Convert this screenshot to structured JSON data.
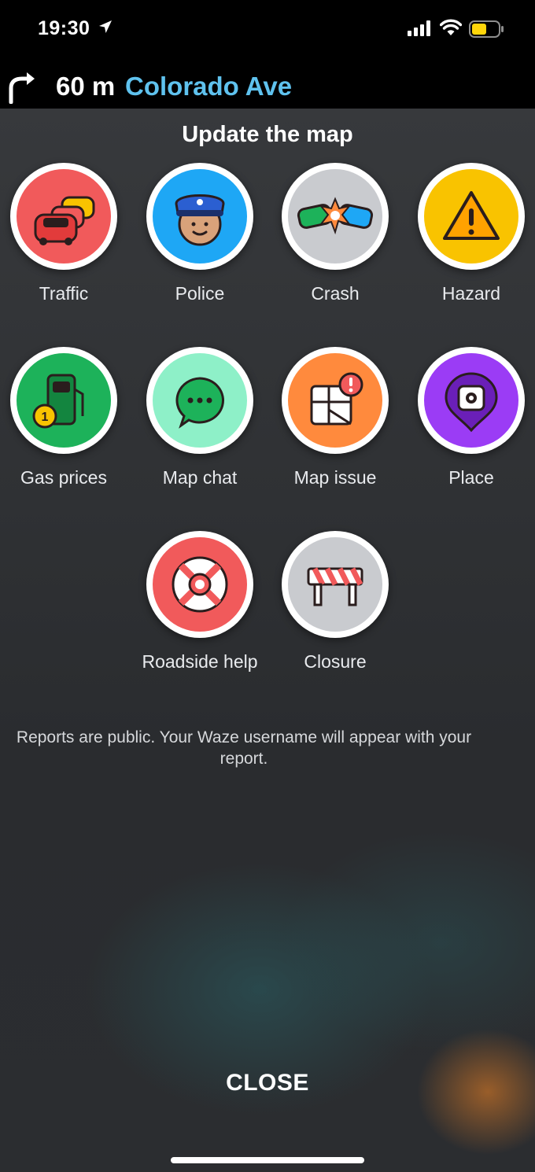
{
  "status_bar": {
    "time": "19:30"
  },
  "navigation": {
    "distance": "60 m",
    "street": "Colorado Ave"
  },
  "title": "Update the map",
  "reports": [
    {
      "label": "Traffic",
      "icon": "traffic-jam-icon",
      "color": "#f15a5b"
    },
    {
      "label": "Police",
      "icon": "police-icon",
      "color": "#1ea7f5"
    },
    {
      "label": "Crash",
      "icon": "crash-icon",
      "color": "#c9cbcf"
    },
    {
      "label": "Hazard",
      "icon": "hazard-icon",
      "color": "#f9c300"
    },
    {
      "label": "Gas prices",
      "icon": "gas-station-icon",
      "color": "#1db25a"
    },
    {
      "label": "Map chat",
      "icon": "chat-bubble-icon",
      "color": "#8ef0c8"
    },
    {
      "label": "Map issue",
      "icon": "map-issue-icon",
      "color": "#ff8a3d"
    },
    {
      "label": "Place",
      "icon": "place-pin-icon",
      "color": "#9b3cf5"
    },
    {
      "label": "Roadside help",
      "icon": "lifebuoy-icon",
      "color": "#f15a5b"
    },
    {
      "label": "Closure",
      "icon": "road-closure-icon",
      "color": "#c9cbcf"
    }
  ],
  "disclaimer": "Reports are public. Your Waze username will appear with your report.",
  "close_label": "CLOSE"
}
